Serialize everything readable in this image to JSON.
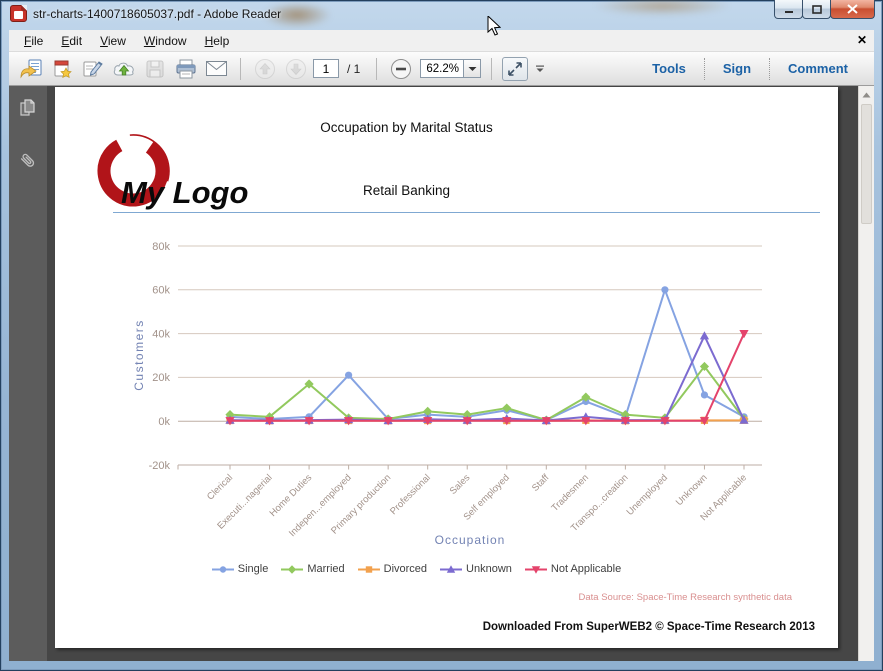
{
  "window": {
    "title": "str-charts-1400718605037.pdf - Adobe Reader"
  },
  "menubar": {
    "items": [
      "File",
      "Edit",
      "View",
      "Window",
      "Help"
    ],
    "close": "✕"
  },
  "toolbar": {
    "page_current": "1",
    "page_total_label": "/ 1",
    "zoom_value": "62.2%",
    "tools_label": "Tools",
    "sign_label": "Sign",
    "comment_label": "Comment"
  },
  "document": {
    "title": "Occupation by Marital Status",
    "subtitle": "Retail Banking",
    "logo_text": "My Logo",
    "data_source": "Data Source: Space-Time Research synthetic data",
    "footer": "Downloaded From SuperWEB2 © Space-Time Research 2013"
  },
  "chart_data": {
    "type": "line",
    "title": "Occupation by Marital Status",
    "xlabel": "Occupation",
    "ylabel": "Customers",
    "ylim": [
      -20000,
      80000
    ],
    "grid": true,
    "legend_position": "bottom",
    "yticks": [
      80000,
      60000,
      40000,
      20000,
      0,
      -20000
    ],
    "ytick_labels": [
      "80k",
      "60k",
      "40k",
      "20k",
      "0k",
      "-20k"
    ],
    "categories": [
      "Clerical",
      "Executi...nagerial",
      "Home Duties",
      "Indepen...employed",
      "Primary production",
      "Professional",
      "Sales",
      "Self employed",
      "Staff",
      "Tradesmen",
      "Transpo...creation",
      "Unemployed",
      "Unknown",
      "Not Applicable"
    ],
    "series": [
      {
        "name": "Single",
        "color": "#85a3e2",
        "marker": "circle",
        "values": [
          2000,
          1000,
          2000,
          21000,
          1000,
          3000,
          2000,
          5000,
          500,
          9000,
          2000,
          60000,
          12000,
          2000
        ]
      },
      {
        "name": "Married",
        "color": "#92c95e",
        "marker": "diamond",
        "values": [
          3000,
          2000,
          17000,
          1500,
          1000,
          4500,
          3000,
          6000,
          500,
          11000,
          3000,
          1500,
          25000,
          1000
        ]
      },
      {
        "name": "Divorced",
        "color": "#f2a14e",
        "marker": "square",
        "values": [
          300,
          200,
          300,
          300,
          200,
          300,
          300,
          300,
          200,
          400,
          200,
          300,
          400,
          400
        ]
      },
      {
        "name": "Unknown",
        "color": "#7c6bd0",
        "marker": "triangle-up",
        "values": [
          500,
          300,
          500,
          700,
          300,
          900,
          500,
          1200,
          300,
          2000,
          500,
          500,
          39000,
          500
        ]
      },
      {
        "name": "Not Applicable",
        "color": "#e4436b",
        "marker": "triangle-down",
        "values": [
          200,
          200,
          200,
          200,
          200,
          200,
          200,
          200,
          200,
          200,
          200,
          200,
          200,
          40000
        ]
      }
    ]
  }
}
